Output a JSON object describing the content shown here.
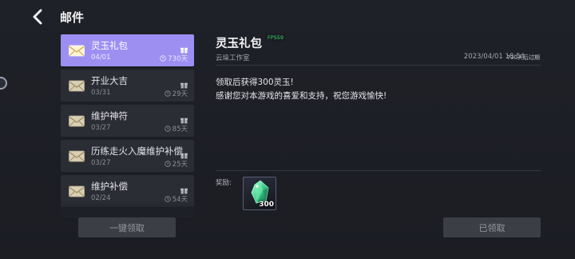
{
  "header": {
    "title": "邮件"
  },
  "mail_list": [
    {
      "title": "灵玉礼包",
      "date": "04/01",
      "expire": "730天",
      "active": true
    },
    {
      "title": "开业大吉",
      "date": "03/31",
      "expire": "29天",
      "active": false
    },
    {
      "title": "维护神符",
      "date": "03/27",
      "expire": "85天",
      "active": false
    },
    {
      "title": "历练走火入魔维护补偿",
      "date": "03/27",
      "expire": "25天",
      "active": false
    },
    {
      "title": "维护补偿",
      "date": "02/24",
      "expire": "54天",
      "active": false
    }
  ],
  "footer": {
    "claim_all_label": "一键领取",
    "claimed_label": "已领取"
  },
  "detail": {
    "title": "灵玉礼包",
    "fps": "FPS59",
    "sender": "云垛工作室",
    "time": "2023/04/01 18:54",
    "expire_note": "730天后过期",
    "body_line1": "领取后获得300灵玉!",
    "body_line2": "感谢您对本游戏的喜爱和支持，祝您游戏愉快!",
    "reward_label": "奖励:",
    "reward": {
      "icon": "jade-crystal-icon",
      "count": "300"
    }
  },
  "colors": {
    "accent": "#9d8ff2",
    "background": "#1f2128",
    "item_bg": "#2b2d35",
    "fps_green": "#2fd86a"
  }
}
